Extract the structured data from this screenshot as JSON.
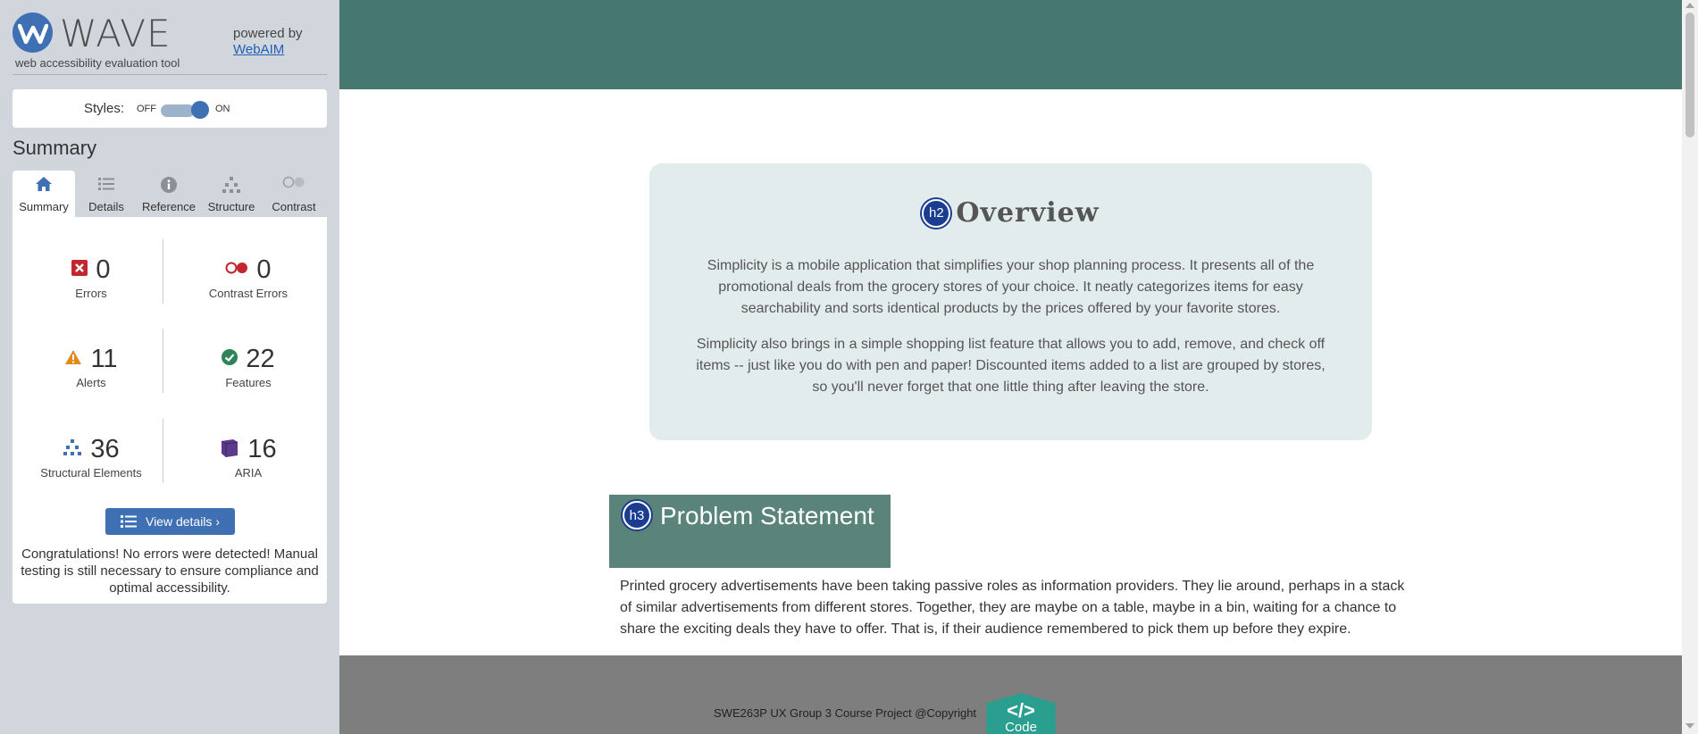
{
  "wave": {
    "logo_word": "WAVE",
    "tagline": "web accessibility evaluation tool",
    "powered_by": "powered by",
    "webaim_link": "WebAIM",
    "styles": {
      "label": "Styles:",
      "off": "OFF",
      "on": "ON",
      "state": "on"
    },
    "summary_heading": "Summary",
    "tabs": [
      {
        "label": "Summary",
        "icon": "home-icon",
        "active": true
      },
      {
        "label": "Details",
        "icon": "list-icon",
        "active": false
      },
      {
        "label": "Reference",
        "icon": "info-icon",
        "active": false
      },
      {
        "label": "Structure",
        "icon": "structure-icon",
        "active": false
      },
      {
        "label": "Contrast",
        "icon": "contrast-icon",
        "active": false
      }
    ],
    "stats": {
      "errors": {
        "count": "0",
        "label": "Errors",
        "icon": "error-icon"
      },
      "contrast_errors": {
        "count": "0",
        "label": "Contrast Errors",
        "icon": "contrast-error-icon"
      },
      "alerts": {
        "count": "11",
        "label": "Alerts",
        "icon": "alert-icon"
      },
      "features": {
        "count": "22",
        "label": "Features",
        "icon": "feature-icon"
      },
      "structural": {
        "count": "36",
        "label": "Structural Elements",
        "icon": "structure-icon"
      },
      "aria": {
        "count": "16",
        "label": "ARIA",
        "icon": "aria-icon"
      }
    },
    "view_details_label": "View details ›",
    "congrats": "Congratulations! No errors were detected! Manual testing is still necessary to ensure compliance and optimal accessibility."
  },
  "page": {
    "overview": {
      "badge": "h2",
      "title": "Overview",
      "paragraphs": [
        "Simplicity is a mobile application that simplifies your shop planning process. It presents all of the promotional deals from the grocery stores of your choice. It neatly categorizes items for easy searchability and sorts identical products by the prices offered by your favorite stores.",
        "Simplicity also brings in a simple shopping list feature that allows you to add, remove, and check off items -- just like you do with pen and paper! Discounted items added to a list are grouped by stores, so you'll never forget that one little thing after leaving the store."
      ]
    },
    "problem": {
      "badge": "h3",
      "title": "Problem Statement",
      "paragraph": "Printed grocery advertisements have been taking passive roles as information providers. They lie around, perhaps in a stack of similar advertisements from different stores. Together, they are maybe on a table, maybe in a bin, waiting for a chance to share the exciting deals they have to offer. That is, if their audience remembered to pick them up before they expire."
    },
    "footer": {
      "copyright": "SWE263P UX Group 3 Course Project @Copyright",
      "code_glyph": "</>",
      "code_label": "Code"
    }
  },
  "colors": {
    "header_teal": "#467770",
    "problem_header": "#5a8379",
    "overview_card": "#e2ecec",
    "footer_gray": "#7e7e7e",
    "wave_blue": "#3f70b4",
    "sidebar_bg": "#d1d6dd"
  }
}
